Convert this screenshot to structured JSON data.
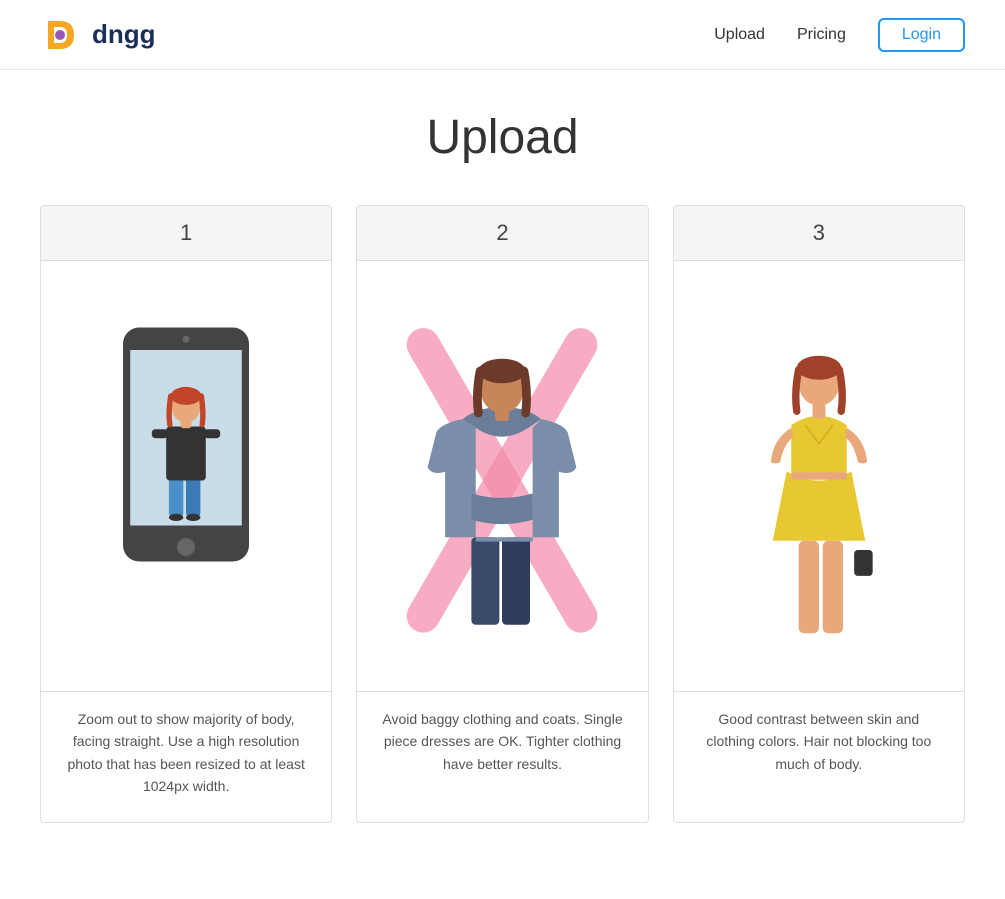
{
  "header": {
    "logo_text": "dngg",
    "nav_upload": "Upload",
    "nav_pricing": "Pricing",
    "nav_login": "Login"
  },
  "main": {
    "page_title": "Upload",
    "cards": [
      {
        "number": "1",
        "description": "Zoom out to show majority of body, facing straight. Use a high resolution photo that has been resized to at least 1024px width."
      },
      {
        "number": "2",
        "description": "Avoid baggy clothing and coats. Single piece dresses are OK. Tighter clothing have better results."
      },
      {
        "number": "3",
        "description": "Good contrast between skin and clothing colors. Hair not blocking too much of body."
      }
    ]
  }
}
